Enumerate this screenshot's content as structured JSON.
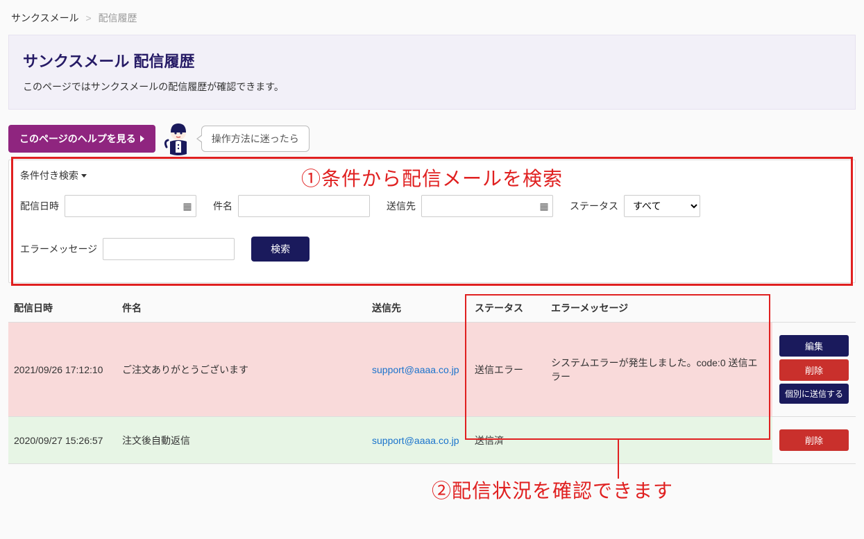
{
  "breadcrumb": {
    "parent": "サンクスメール",
    "sep": ">",
    "current": "配信履歴"
  },
  "title_panel": {
    "title": "サンクスメール 配信履歴",
    "desc": "このページではサンクスメールの配信履歴が確認できます。"
  },
  "help": {
    "button_label": "このページのヘルプを見る",
    "bubble_text": "操作方法に迷ったら"
  },
  "annotations": {
    "label1": "①条件から配信メールを検索",
    "label2": "②配信状況を確認できます"
  },
  "search": {
    "header": "条件付き検索",
    "fields": {
      "date_label": "配信日時",
      "subject_label": "件名",
      "recipient_label": "送信先",
      "status_label": "ステータス",
      "error_label": "エラーメッセージ"
    },
    "status_selected": "すべて",
    "submit_label": "検索"
  },
  "table": {
    "headers": {
      "date": "配信日時",
      "subject": "件名",
      "recipient": "送信先",
      "status": "ステータス",
      "error": "エラーメッセージ"
    },
    "rows": [
      {
        "date": "2021/09/26 17:12:10",
        "subject": "ご注文ありがとうございます",
        "recipient": "support@aaaa.co.jp",
        "status": "送信エラー",
        "error": "システムエラーが発生しました。code:0 送信エラー",
        "row_class": "row-error",
        "actions": {
          "edit": "編集",
          "delete": "削除",
          "send": "個別に送信する"
        }
      },
      {
        "date": "2020/09/27 15:26:57",
        "subject": "注文後自動返信",
        "recipient": "support@aaaa.co.jp",
        "status": "送信済",
        "error": "",
        "row_class": "row-ok",
        "actions": {
          "delete": "削除"
        }
      }
    ]
  }
}
